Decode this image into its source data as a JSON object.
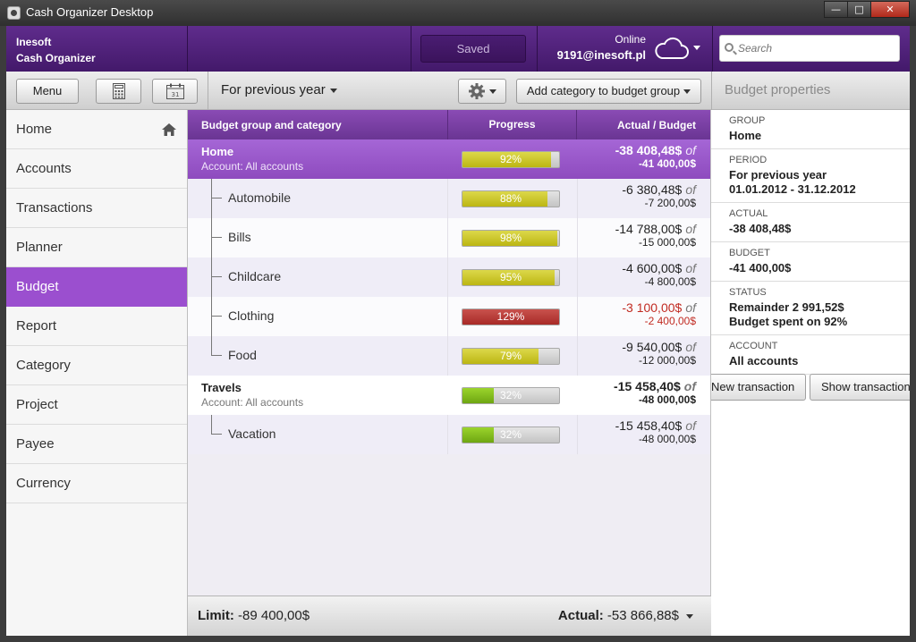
{
  "window": {
    "title": "Cash Organizer Desktop",
    "minimize": "—",
    "maximize": "□",
    "close": "✕"
  },
  "header": {
    "brand_line1": "Inesoft",
    "brand_line2": "Cash Organizer",
    "saved_label": "Saved",
    "online_label": "Online",
    "account": "9191@inesoft.pl",
    "search_placeholder": "Search"
  },
  "toolbar": {
    "menu_label": "Menu",
    "period_label": "For previous year",
    "add_category_label": "Add category to budget group",
    "props_title": "Budget properties"
  },
  "sidebar": {
    "items": [
      {
        "label": "Home"
      },
      {
        "label": "Accounts"
      },
      {
        "label": "Transactions"
      },
      {
        "label": "Planner"
      },
      {
        "label": "Budget",
        "active": true
      },
      {
        "label": "Report"
      },
      {
        "label": "Category"
      },
      {
        "label": "Project"
      },
      {
        "label": "Payee"
      },
      {
        "label": "Currency"
      }
    ]
  },
  "table": {
    "headers": {
      "name": "Budget group and category",
      "progress": "Progress",
      "amount": "Actual / Budget"
    },
    "of_label": "of",
    "groups": [
      {
        "name": "Home",
        "account": "Account: All accounts",
        "progress": 92,
        "actual": "-38 408,48$",
        "budget": "-41 400,00$",
        "categories": [
          {
            "name": "Automobile",
            "progress": 88,
            "actual": "-6 380,48$",
            "budget": "-7 200,00$"
          },
          {
            "name": "Bills",
            "progress": 98,
            "actual": "-14 788,00$",
            "budget": "-15 000,00$"
          },
          {
            "name": "Childcare",
            "progress": 95,
            "actual": "-4 600,00$",
            "budget": "-4 800,00$"
          },
          {
            "name": "Clothing",
            "progress": 129,
            "actual": "-3 100,00$",
            "budget": "-2 400,00$",
            "over": true
          },
          {
            "name": "Food",
            "progress": 79,
            "actual": "-9 540,00$",
            "budget": "-12 000,00$"
          }
        ]
      },
      {
        "name": "Travels",
        "account": "Account: All accounts",
        "progress": 32,
        "actual": "-15 458,40$",
        "budget": "-48 000,00$",
        "categories": [
          {
            "name": "Vacation",
            "progress": 32,
            "actual": "-15 458,40$",
            "budget": "-48 000,00$"
          }
        ]
      }
    ],
    "footer": {
      "limit_label": "Limit:",
      "limit_value": "-89 400,00$",
      "actual_label": "Actual:",
      "actual_value": "-53 866,88$"
    }
  },
  "properties": {
    "items": [
      {
        "label": "GROUP",
        "value": "Home"
      },
      {
        "label": "PERIOD",
        "value": "For previous year",
        "value2": "01.01.2012 - 31.12.2012"
      },
      {
        "label": "ACTUAL",
        "value": "-38 408,48$"
      },
      {
        "label": "BUDGET",
        "value": "-41 400,00$"
      },
      {
        "label": "STATUS",
        "value": "Remainder 2 991,52$",
        "value2": "Budget spent on 92%"
      },
      {
        "label": "ACCOUNT",
        "value": "All accounts"
      }
    ],
    "new_transaction_label": "New transaction",
    "show_transactions_label": "Show transactions"
  },
  "colors": {
    "brand": "#5f2c8c",
    "active": "#9b4fcf",
    "progress_ok": "#c9c424",
    "progress_over": "#b23631",
    "progress_low": "#84bd1e"
  }
}
